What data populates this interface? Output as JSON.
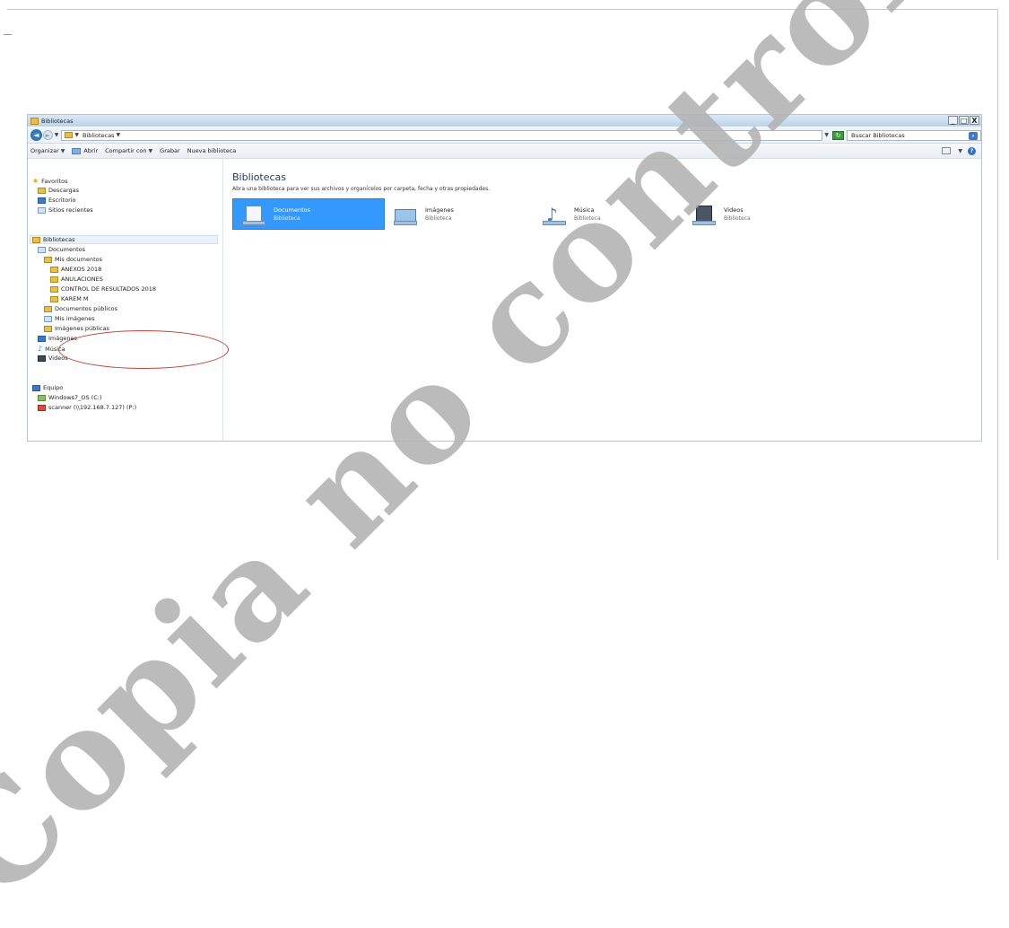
{
  "window": {
    "title": "Bibliotecas",
    "controls": [
      "_",
      "□",
      "X"
    ]
  },
  "address": {
    "crumb": "Bibliotecas",
    "search_placeholder": "Buscar Bibliotecas"
  },
  "toolbar": {
    "organize": "Organizar",
    "open": "Abrir",
    "share": "Compartir con",
    "burn": "Grabar",
    "new_library": "Nueva biblioteca"
  },
  "nav": {
    "favorites": "Favoritos",
    "downloads": "Descargas",
    "desktop": "Escritorio",
    "recent": "Sitios recientes",
    "libraries": "Bibliotecas",
    "documents": "Documentos",
    "my_documents": "Mis documentos",
    "anexos": "ANEXOS 2018",
    "anulaciones": "ANULACIONES",
    "control": "CONTROL DE RESULTADOS 2018",
    "karem": "KAREM M",
    "public_docs": "Documentos públicos",
    "my_images": "Mis imágenes",
    "public_images": "Imágenes públicas",
    "images": "Imágenes",
    "music": "Música",
    "videos": "Videos",
    "computer": "Equipo",
    "drive_c": "Windows7_OS (C:)",
    "scanner": "scanner (\\\\192.168.7.127) (P:)"
  },
  "content": {
    "title": "Bibliotecas",
    "subtitle": "Abra una biblioteca para ver sus archivos y organícelos por carpeta, fecha y otras propiedades.",
    "libraries": [
      {
        "name": "Documentos",
        "type": "Biblioteca"
      },
      {
        "name": "Imágenes",
        "type": "Biblioteca"
      },
      {
        "name": "Música",
        "type": "Biblioteca"
      },
      {
        "name": "Videos",
        "type": "Biblioteca"
      }
    ]
  },
  "watermark": "Copia no controlada"
}
